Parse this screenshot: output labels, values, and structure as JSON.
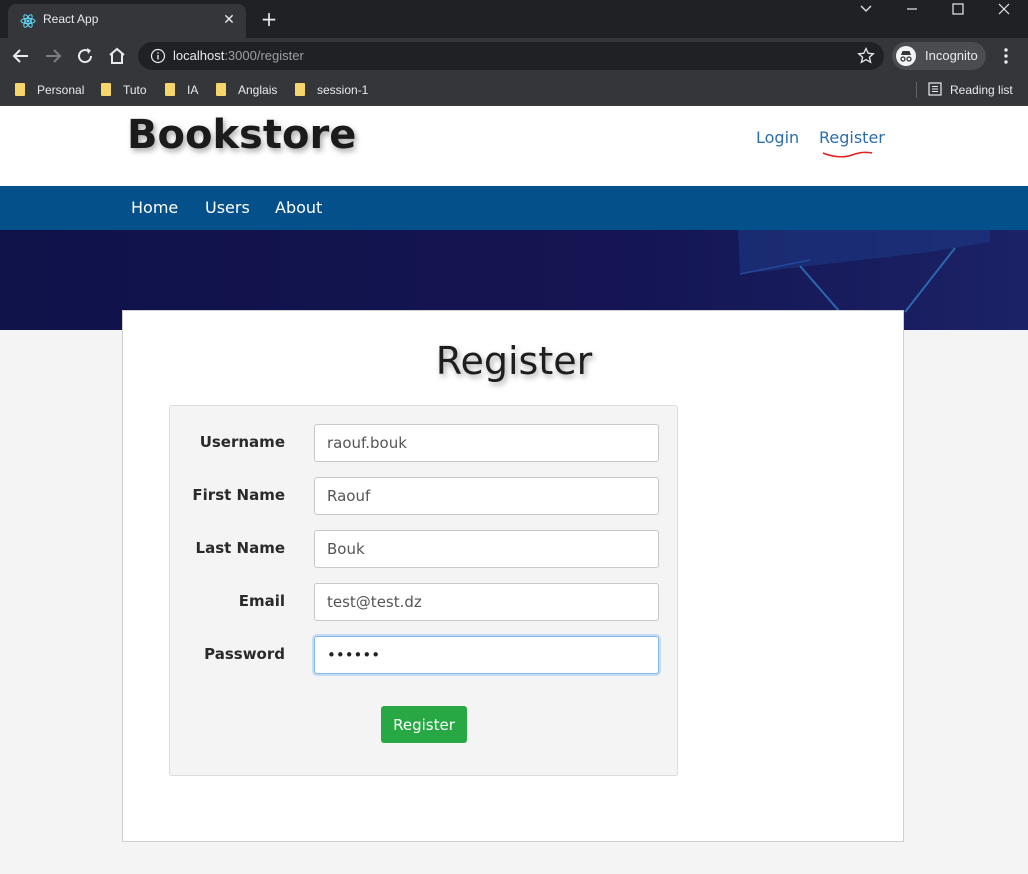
{
  "browser": {
    "tab_title": "React App",
    "url_host": "localhost",
    "url_path": ":3000/register",
    "profile_label": "Incognito",
    "bookmarks": [
      "Personal",
      "Tuto",
      "IA",
      "Anglais",
      "session-1"
    ],
    "reading_list_label": "Reading list"
  },
  "site": {
    "brand": "Bookstore",
    "top_links": {
      "login": "Login",
      "register": "Register"
    },
    "nav": {
      "home": "Home",
      "users": "Users",
      "about": "About"
    }
  },
  "register_form": {
    "title": "Register",
    "fields": {
      "username": {
        "label": "Username",
        "value": "raouf.bouk"
      },
      "first_name": {
        "label": "First Name",
        "value": "Raouf"
      },
      "last_name": {
        "label": "Last Name",
        "value": "Bouk"
      },
      "email": {
        "label": "Email",
        "value": "test@test.dz"
      },
      "password": {
        "label": "Password",
        "value": "123456"
      }
    },
    "submit_label": "Register"
  },
  "colors": {
    "nav_bar": "#03508a",
    "link": "#2c6ea8",
    "submit_button": "#27a844",
    "hero": "#10124a"
  }
}
